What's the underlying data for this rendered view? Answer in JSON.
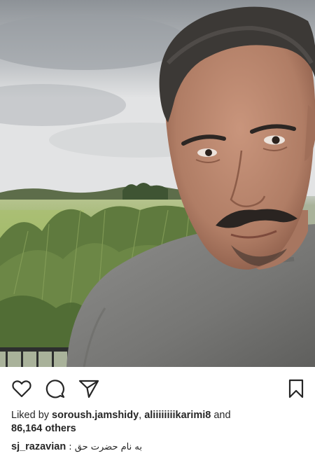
{
  "post": {
    "photo_alt_name": "selfie-photo",
    "actions": {
      "like_icon": "heart-icon",
      "comment_icon": "speech-bubble-icon",
      "share_icon": "paper-plane-icon",
      "save_icon": "bookmark-icon"
    },
    "likes": {
      "prefix": "Liked by ",
      "user1": "soroush.jamshidy",
      "separator": ", ",
      "user2": "aliiiiiiiikarimi8",
      "conj": " and",
      "count": "86,164",
      "suffix": " others"
    },
    "caption": {
      "username": "sj_razavian",
      "text": "به نام حضرت حق :"
    }
  }
}
